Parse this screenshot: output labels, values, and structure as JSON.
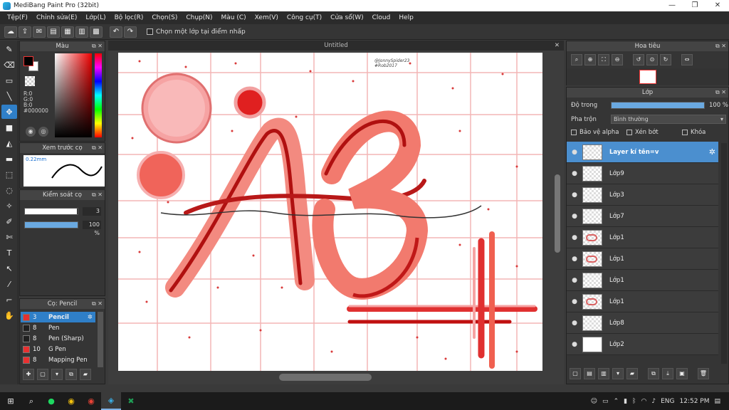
{
  "window": {
    "title": "MediBang Paint Pro (32bit)",
    "controls": [
      "—",
      "❐",
      "✕"
    ]
  },
  "menu": [
    "Tệp(F)",
    "Chỉnh sửa(E)",
    "Lớp(L)",
    "Bộ lọc(R)",
    "Chọn(S)",
    "Chụp(N)",
    "Màu (C)",
    "Xem(V)",
    "Công cụ(T)",
    "Cửa sổ(W)",
    "Cloud",
    "Help"
  ],
  "toolbar": {
    "checkbox_label": "Chọn một lớp tại điểm nhấp"
  },
  "color_panel": {
    "title": "Màu",
    "r": "R:0",
    "g": "G:0",
    "b": "B:0",
    "hex": "#000000"
  },
  "preview_panel": {
    "title": "Xem trước cọ",
    "size": "0.22mm"
  },
  "brush_control": {
    "title": "Kiểm soát cọ",
    "size_value": "3",
    "opacity_value": "100 %",
    "size_fraction": 0.98,
    "opacity_fraction": 1.0
  },
  "brush_panel": {
    "title": "Cọ: Pencil",
    "items": [
      {
        "size": "3",
        "name": "Pencil",
        "color": "#e33030",
        "active": true
      },
      {
        "size": "8",
        "name": "Pen",
        "color": "#202020",
        "active": false
      },
      {
        "size": "8",
        "name": "Pen (Sharp)",
        "color": "#202020",
        "active": false
      },
      {
        "size": "10",
        "name": "G Pen",
        "color": "#e83030",
        "active": false
      },
      {
        "size": "8",
        "name": "Mapping Pen",
        "color": "#e83030",
        "active": false
      }
    ]
  },
  "canvas": {
    "tab": "Untitled",
    "signature": "@JonnySpider23\n#Rob2017",
    "letters": "AE"
  },
  "navigator": {
    "title": "Hoa tiêu"
  },
  "layer_panel": {
    "title": "Lớp",
    "opacity_label": "Độ trong",
    "opacity_value": "100 %",
    "blend_label": "Pha trộn",
    "blend_value": "Bình thường",
    "checkboxes": [
      "Bảo vệ alpha",
      "Xén bớt",
      "Khóa"
    ],
    "layers": [
      {
        "name": "Layer kí tên=v",
        "active": true,
        "thumb": "blank"
      },
      {
        "name": "Lớp9",
        "active": false,
        "thumb": "blank"
      },
      {
        "name": "Lớp3",
        "active": false,
        "thumb": "blank"
      },
      {
        "name": "Lớp7",
        "active": false,
        "thumb": "blank"
      },
      {
        "name": "Lớp1",
        "active": false,
        "thumb": "ink"
      },
      {
        "name": "Lớp1",
        "active": false,
        "thumb": "ink"
      },
      {
        "name": "Lớp1",
        "active": false,
        "thumb": "blank"
      },
      {
        "name": "Lớp1",
        "active": false,
        "thumb": "ink"
      },
      {
        "name": "Lớp8",
        "active": false,
        "thumb": "blank"
      },
      {
        "name": "Lớp2",
        "active": false,
        "thumb": "white"
      }
    ]
  },
  "taskbar": {
    "lang": "ENG",
    "time": "12:52 PM"
  },
  "colors": {
    "accent": "#2f7fc8",
    "ink": "#d93a3a",
    "pink": "#f4a0a0"
  }
}
